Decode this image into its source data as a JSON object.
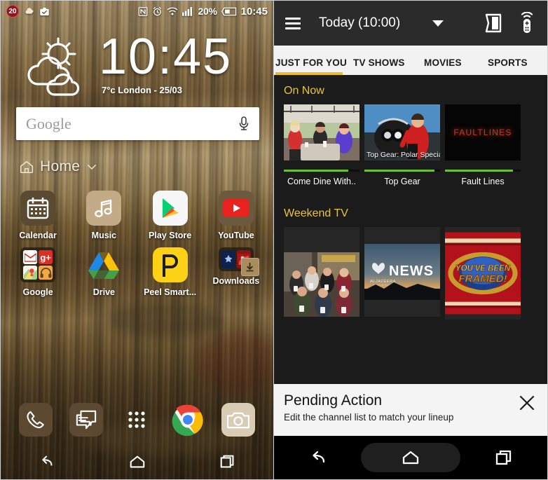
{
  "left_phone": {
    "status_bar": {
      "notification_badge": "20",
      "icons_left": [
        "notification-badge-20",
        "cloud-icon",
        "briefcase-check-icon"
      ],
      "icons_right": [
        "nfc-icon",
        "alarm-icon",
        "wifi-icon",
        "signal-icon"
      ],
      "battery_percent": "20%",
      "clock": "10:45"
    },
    "weather_widget": {
      "icon": "partly-cloudy-icon",
      "clock": "10:45",
      "temperature": "7",
      "degree_unit": "°c",
      "location": "London",
      "date": "25/03",
      "subtitle": "7°c London - 25/03"
    },
    "search": {
      "label": "Google",
      "placeholder": "Google",
      "mic_icon": "microphone-icon"
    },
    "page_indicator": {
      "home_icon": "home-outline-icon",
      "label": "Home",
      "chevron": "chevron-down-icon"
    },
    "apps": [
      [
        {
          "label": "Calendar",
          "icon": "calendar-icon",
          "type": "app"
        },
        {
          "label": "Music",
          "icon": "music-note-icon",
          "type": "app"
        },
        {
          "label": "Play Store",
          "icon": "play-store-icon",
          "type": "app"
        },
        {
          "label": "YouTube",
          "icon": "youtube-icon",
          "type": "app"
        }
      ],
      [
        {
          "label": "Google",
          "icon": "google-folder-icon",
          "type": "folder"
        },
        {
          "label": "Drive",
          "icon": "google-drive-icon",
          "type": "app"
        },
        {
          "label": "Peel Smart...",
          "icon": "peel-smart-remote-icon",
          "type": "app"
        },
        {
          "label": "Downloads",
          "icon": "downloads-folder-icon",
          "type": "folder"
        }
      ]
    ],
    "dock": [
      {
        "icon": "phone-icon",
        "name": "phone"
      },
      {
        "icon": "messages-icon",
        "name": "messages"
      },
      {
        "icon": "app-drawer-icon",
        "name": "app-drawer"
      },
      {
        "icon": "chrome-icon",
        "name": "chrome"
      },
      {
        "icon": "camera-icon",
        "name": "camera"
      }
    ],
    "navbar": [
      {
        "icon": "back-icon",
        "name": "back"
      },
      {
        "icon": "home-icon",
        "name": "home"
      },
      {
        "icon": "recents-icon",
        "name": "recents"
      }
    ]
  },
  "right_phone": {
    "header": {
      "menu_icon": "hamburger-menu-icon",
      "title": "Today (10:00)",
      "dropdown_icon": "caret-down-icon",
      "guide_icon": "tv-guide-book-icon",
      "remote_icon": "remote-control-icon"
    },
    "tabs": [
      {
        "label": "JUST FOR YOU",
        "active": true
      },
      {
        "label": "TV SHOWS",
        "active": false
      },
      {
        "label": "MOVIES",
        "active": false
      },
      {
        "label": "SPORTS",
        "active": false
      }
    ],
    "sections": [
      {
        "title": "On Now",
        "cards": [
          {
            "label": "Come Dine With..",
            "overlay": "",
            "progress": 85,
            "art": "dinner-party-photo"
          },
          {
            "label": "Top Gear",
            "overlay": "Top Gear: Polar Special",
            "progress": 93,
            "art": "top-gear-motorbike-photo"
          },
          {
            "label": "Fault Lines",
            "overlay": "FAULTLINES",
            "progress": 90,
            "art": "faultlines-logo"
          }
        ]
      },
      {
        "title": "Weekend TV",
        "cards": [
          {
            "label": "",
            "overlay": "",
            "art": "sitcom-cast-photo"
          },
          {
            "label": "",
            "overlay": "NEWS",
            "sub_overlay": "ALJAZEERA",
            "art": "aljazeera-news-photo"
          },
          {
            "label": "",
            "overlay": "YOU'VE BEEN FRAMED!",
            "art": "youve-been-framed-logo"
          }
        ]
      }
    ],
    "pending_action": {
      "title": "Pending Action",
      "message": "Edit the channel list to match your lineup",
      "close_icon": "close-icon"
    },
    "navbar": [
      {
        "icon": "back-icon",
        "name": "back"
      },
      {
        "icon": "home-icon",
        "name": "home"
      },
      {
        "icon": "recents-icon",
        "name": "recents"
      }
    ]
  },
  "colors": {
    "accent_yellow": "#e9c531",
    "tab_underline": "#e9bf1d",
    "progress_green": "#6fbf2e",
    "header_dark": "#2b2b2b",
    "body_dark": "#1b1b1b",
    "badge_red": "#8e1520"
  }
}
